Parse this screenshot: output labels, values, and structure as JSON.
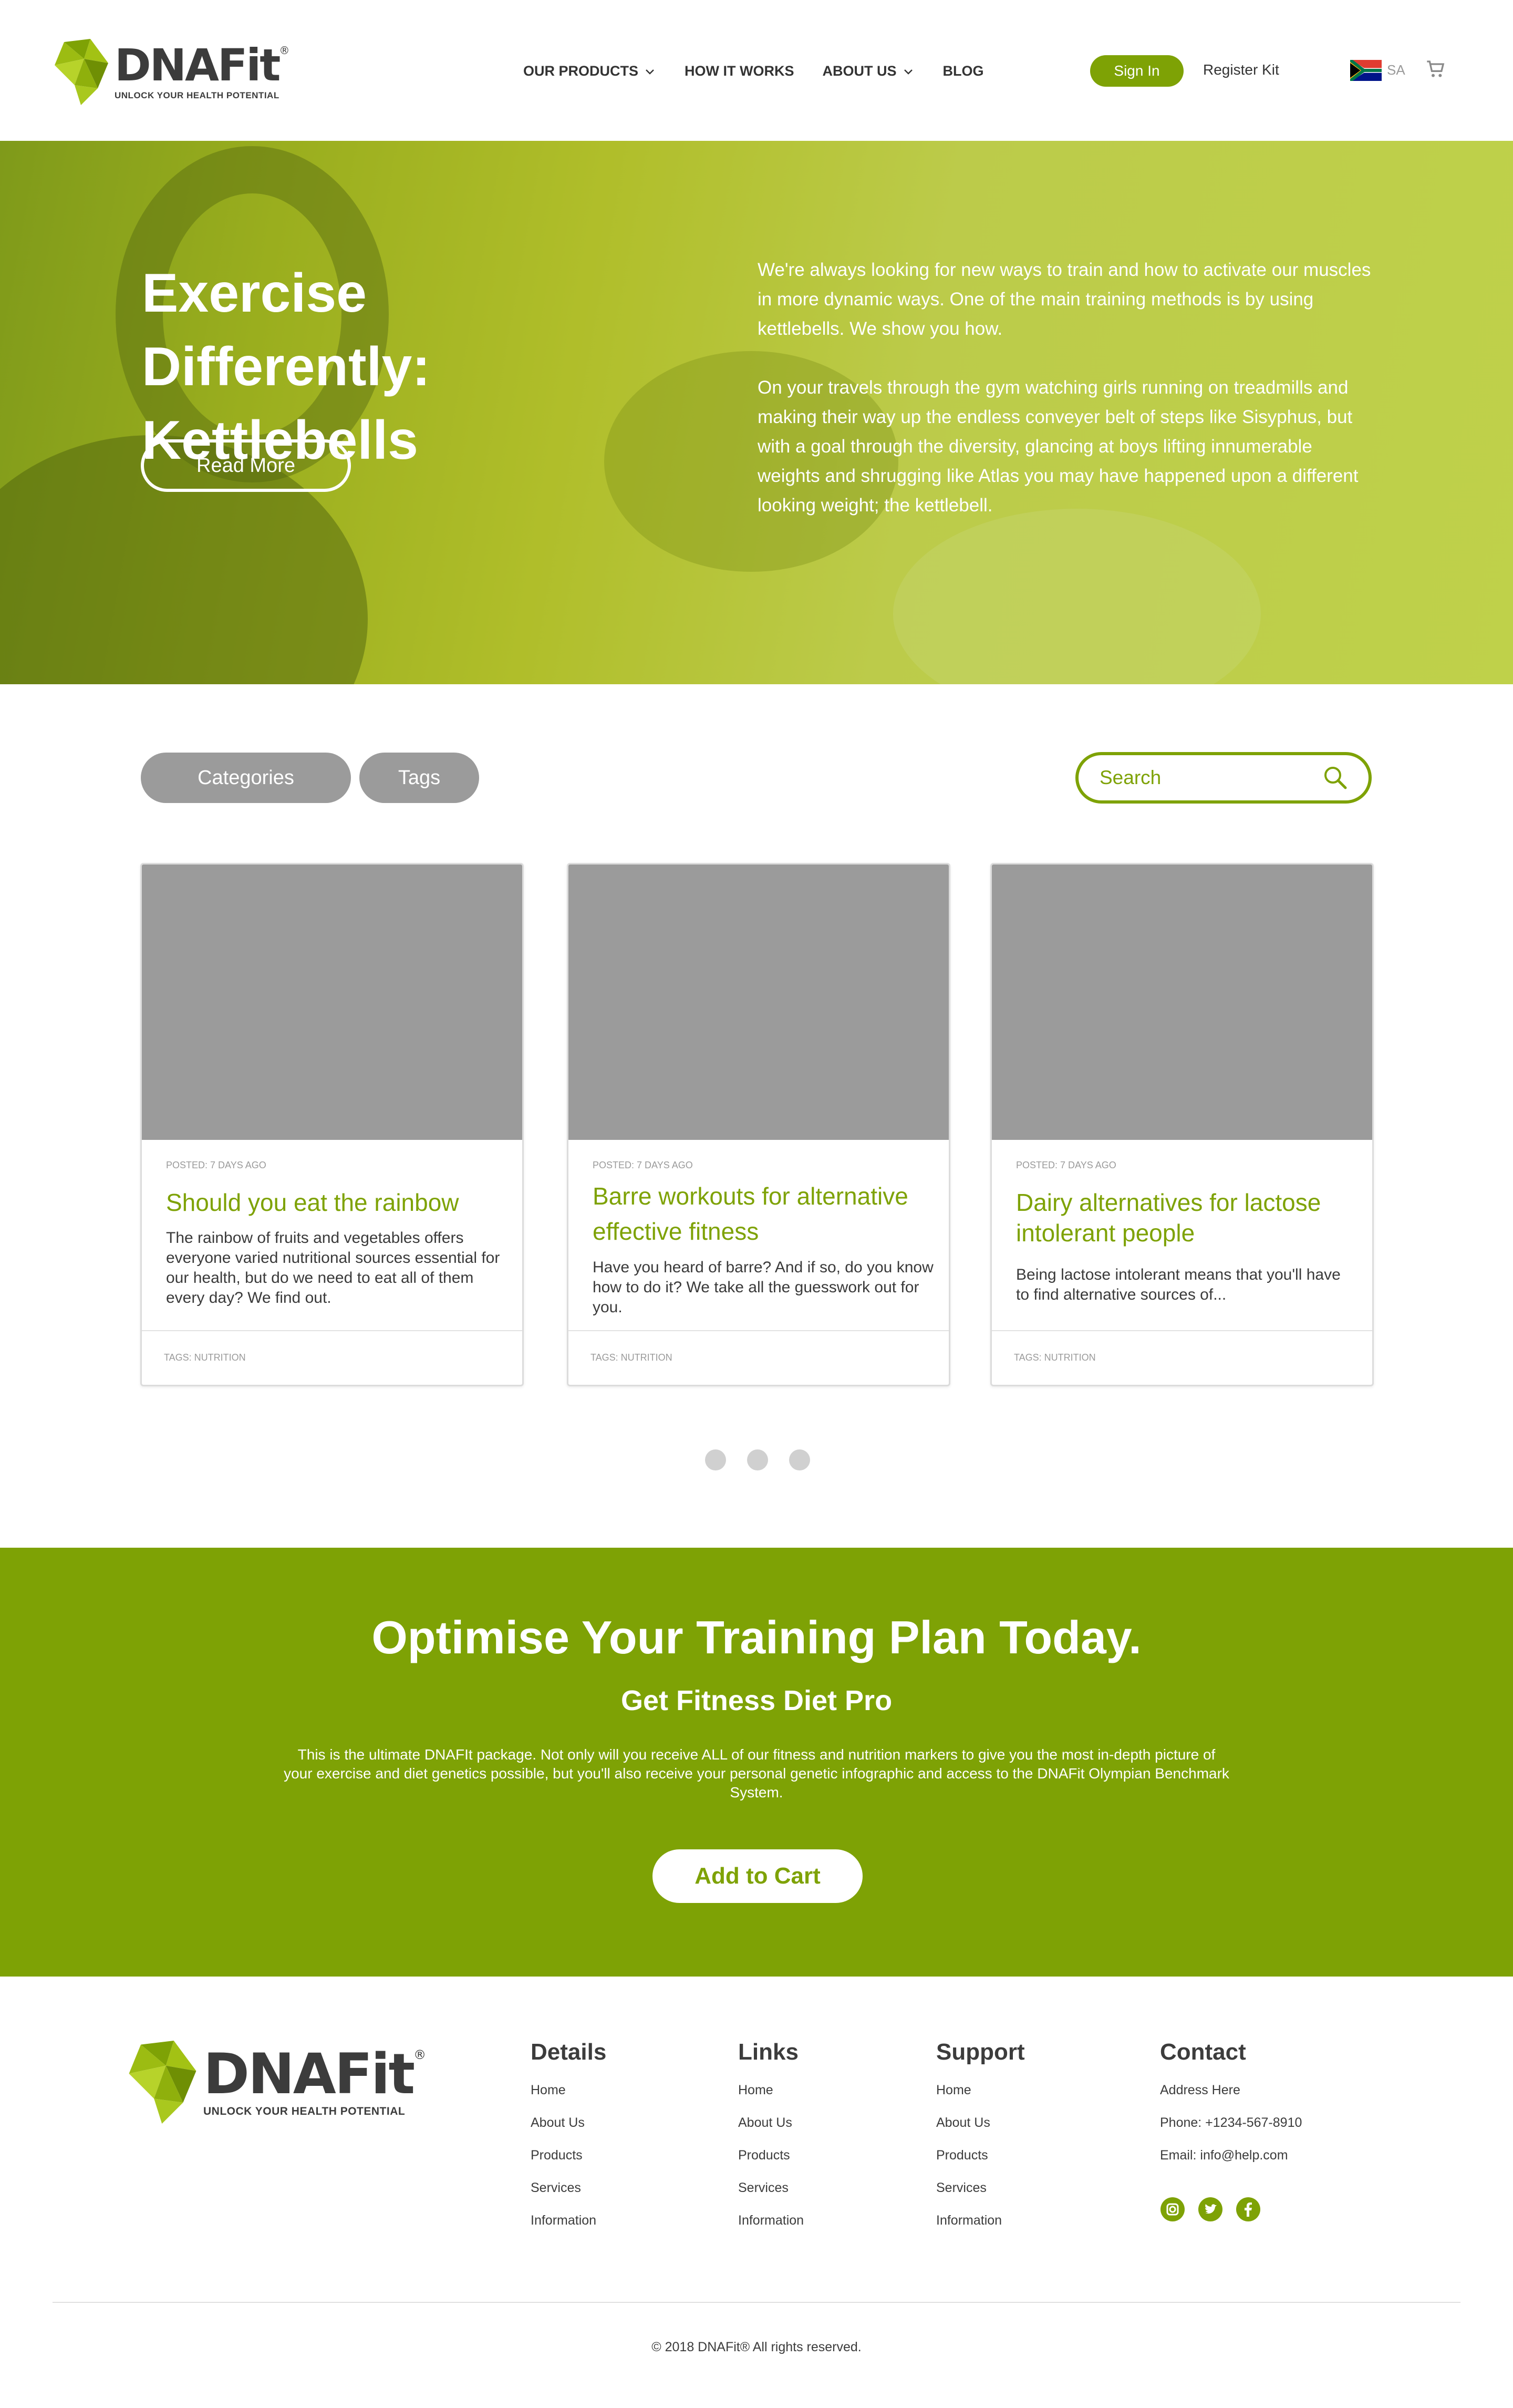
{
  "brand": {
    "name": "DNAFit",
    "registered": "®",
    "tagline": "UNLOCK YOUR HEALTH POTENTIAL",
    "colors": {
      "primary_green": "#7ea205",
      "light_green": "#b6c93a",
      "dark_text": "#3c3c3c",
      "gray": "#9b9b9b"
    }
  },
  "nav": {
    "items": [
      {
        "label": "OUR PRODUCTS",
        "dropdown": true
      },
      {
        "label": "HOW IT WORKS",
        "dropdown": false
      },
      {
        "label": "ABOUT US",
        "dropdown": true
      },
      {
        "label": "BLOG",
        "dropdown": false
      }
    ],
    "sign_in": "Sign In",
    "register": "Register Kit",
    "region": "SA",
    "flag_icon": "south-africa-flag-icon",
    "cart_icon": "cart-icon"
  },
  "hero": {
    "title_line1": "Exercise Differently:",
    "title_line2": "Kettlebells",
    "button": "Read More",
    "paragraph1": "We're always looking for new ways to train and how to activate our muscles in more dynamic ways. One of the main training methods is by using kettlebells. We show you how.",
    "paragraph2": "On your travels through the gym watching girls running on treadmills and making their way up the endless conveyer belt of steps like Sisyphus, but with a goal through the diversity, glancing at boys lifting innumerable weights and shrugging like Atlas you may have happened upon a different looking weight; the kettlebell."
  },
  "filters": {
    "categories": "Categories",
    "tags": "Tags",
    "search_placeholder": "Search"
  },
  "cards": [
    {
      "posted": "POSTED: 7 DAYS AGO",
      "title": "Should you eat the rainbow",
      "body": "The rainbow of fruits and vegetables offers everyone varied nutritional sources essential for our health, but do we need to eat all of them every day? We find out.",
      "tags": "TAGS: NUTRITION"
    },
    {
      "posted": "POSTED: 7 DAYS AGO",
      "title": "Barre workouts for alternative effective fitness",
      "body": "Have you heard of barre? And if so, do you know how to do it? We take all the guesswork out for you.",
      "tags": "TAGS: NUTRITION"
    },
    {
      "posted": "POSTED: 7 DAYS AGO",
      "title": "Dairy alternatives for lactose intolerant people",
      "body": "Being lactose intolerant means that you'll have to find alternative sources of...",
      "tags": "TAGS: NUTRITION"
    }
  ],
  "carousel": {
    "pages": 3
  },
  "cta": {
    "title": "Optimise Your Training Plan Today.",
    "subtitle": "Get Fitness Diet Pro",
    "text": "This is the ultimate DNAFIt package. Not only will you receive ALL of our fitness and nutrition markers to give you the most in-depth picture of your exercise and diet genetics possible, but you'll also receive your personal genetic infographic and access to the DNAFit Olympian Benchmark System.",
    "button": "Add to Cart"
  },
  "footer": {
    "columns": [
      {
        "heading": "Details",
        "links": [
          "Home",
          "About Us",
          "Products",
          "Services",
          "Information"
        ]
      },
      {
        "heading": "Links",
        "links": [
          "Home",
          "About Us",
          "Products",
          "Services",
          "Information"
        ]
      },
      {
        "heading": "Support",
        "links": [
          "Home",
          "About Us",
          "Products",
          "Services",
          "Information"
        ]
      }
    ],
    "contact": {
      "heading": "Contact",
      "address": "Address Here",
      "phone": "Phone: +1234-567-8910",
      "email": "Email: info@help.com",
      "social": [
        "instagram-icon",
        "twitter-icon",
        "facebook-icon"
      ]
    },
    "copyright": "© 2018 DNAFit® All rights reserved."
  }
}
